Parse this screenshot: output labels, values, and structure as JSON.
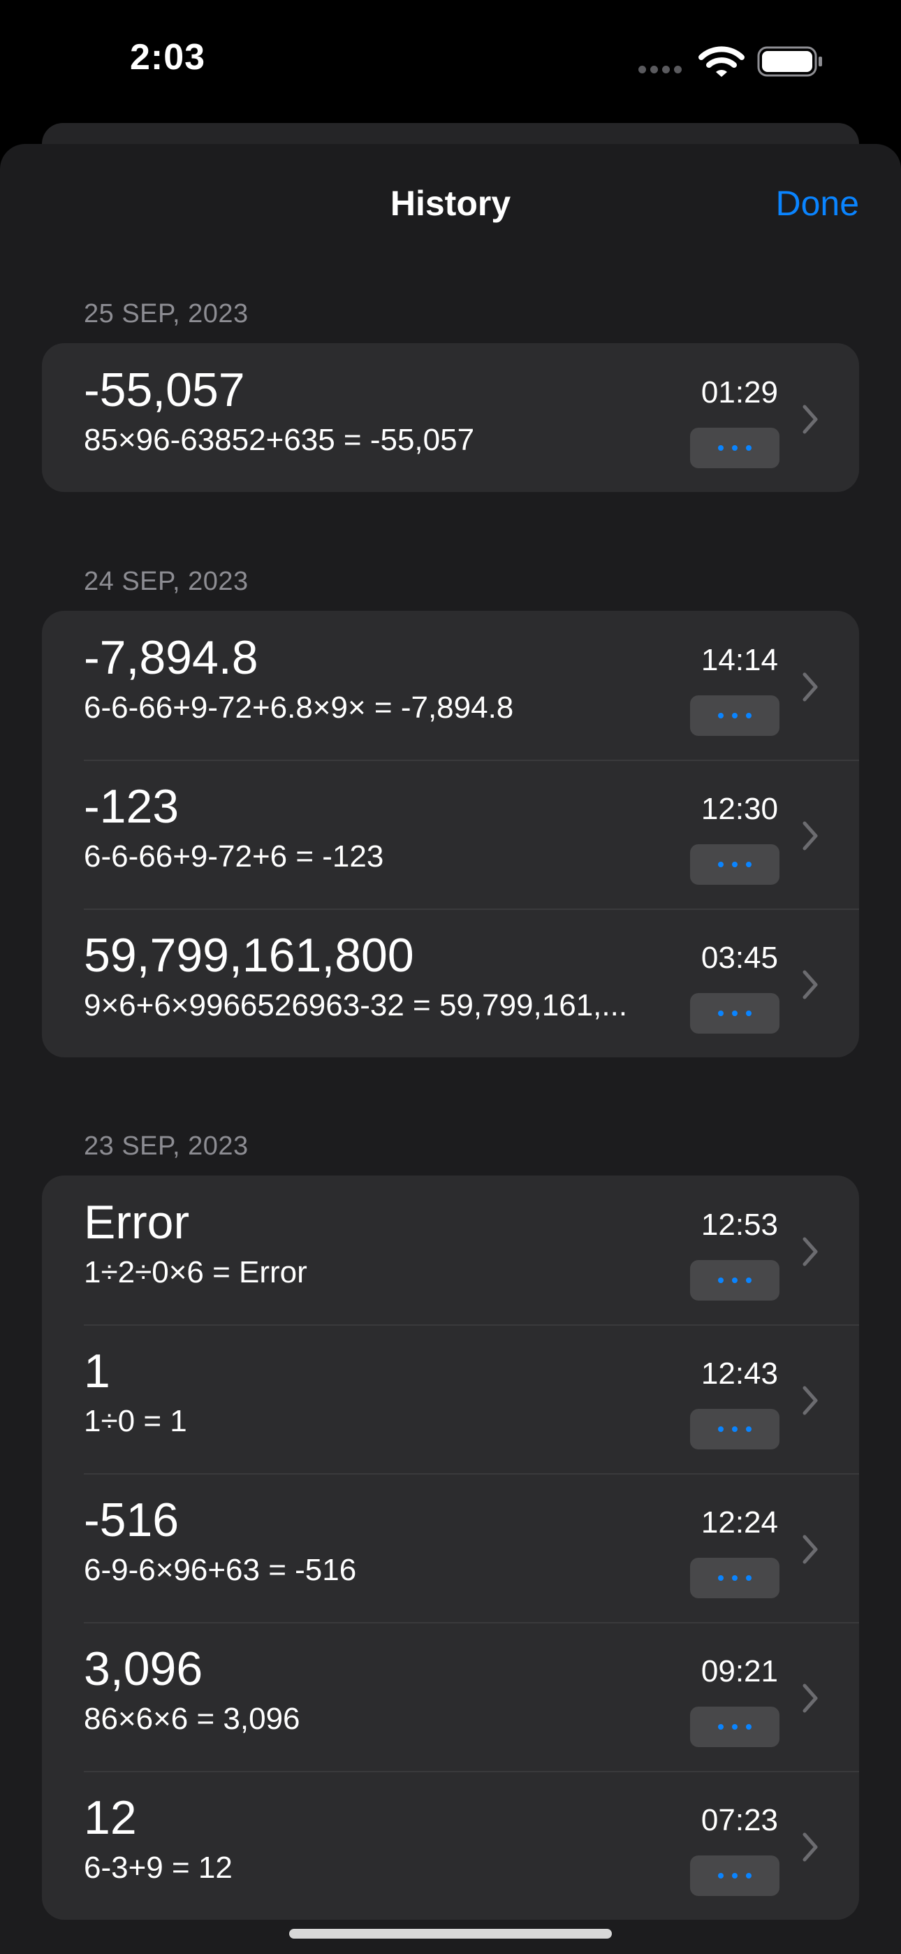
{
  "status_bar": {
    "time": "2:03"
  },
  "nav": {
    "title": "History",
    "done_label": "Done"
  },
  "sections": [
    {
      "date": "25 SEP, 2023",
      "entries": [
        {
          "result": "-55,057",
          "expression": "85×96-63852+635 = -55,057",
          "time": "01:29"
        }
      ]
    },
    {
      "date": "24 SEP, 2023",
      "entries": [
        {
          "result": "-7,894.8",
          "expression": "6-6-66+9-72+6.8×9× = -7,894.8",
          "time": "14:14"
        },
        {
          "result": "-123",
          "expression": "6-6-66+9-72+6 = -123",
          "time": "12:30"
        },
        {
          "result": "59,799,161,800",
          "expression": "9×6+6×9966526963-32 = 59,799,161,...",
          "time": "03:45"
        }
      ]
    },
    {
      "date": "23 SEP, 2023",
      "entries": [
        {
          "result": "Error",
          "expression": "1÷2÷0×6 = Error",
          "time": "12:53"
        },
        {
          "result": "1",
          "expression": "1÷0 = 1",
          "time": "12:43"
        },
        {
          "result": "-516",
          "expression": "6-9-6×96+63 = -516",
          "time": "12:24"
        },
        {
          "result": "3,096",
          "expression": "86×6×6 = 3,096",
          "time": "09:21"
        },
        {
          "result": "12",
          "expression": "6-3+9 = 12",
          "time": "07:23"
        }
      ]
    }
  ],
  "colors": {
    "accent": "#0a84ff",
    "background": "#1c1c1e",
    "card": "#2c2c2e",
    "secondary_text": "#8d8d93"
  },
  "icons": {
    "wifi": "wifi-icon",
    "battery": "battery-icon",
    "chevron": "chevron-right-icon",
    "more": "ellipsis-icon"
  }
}
